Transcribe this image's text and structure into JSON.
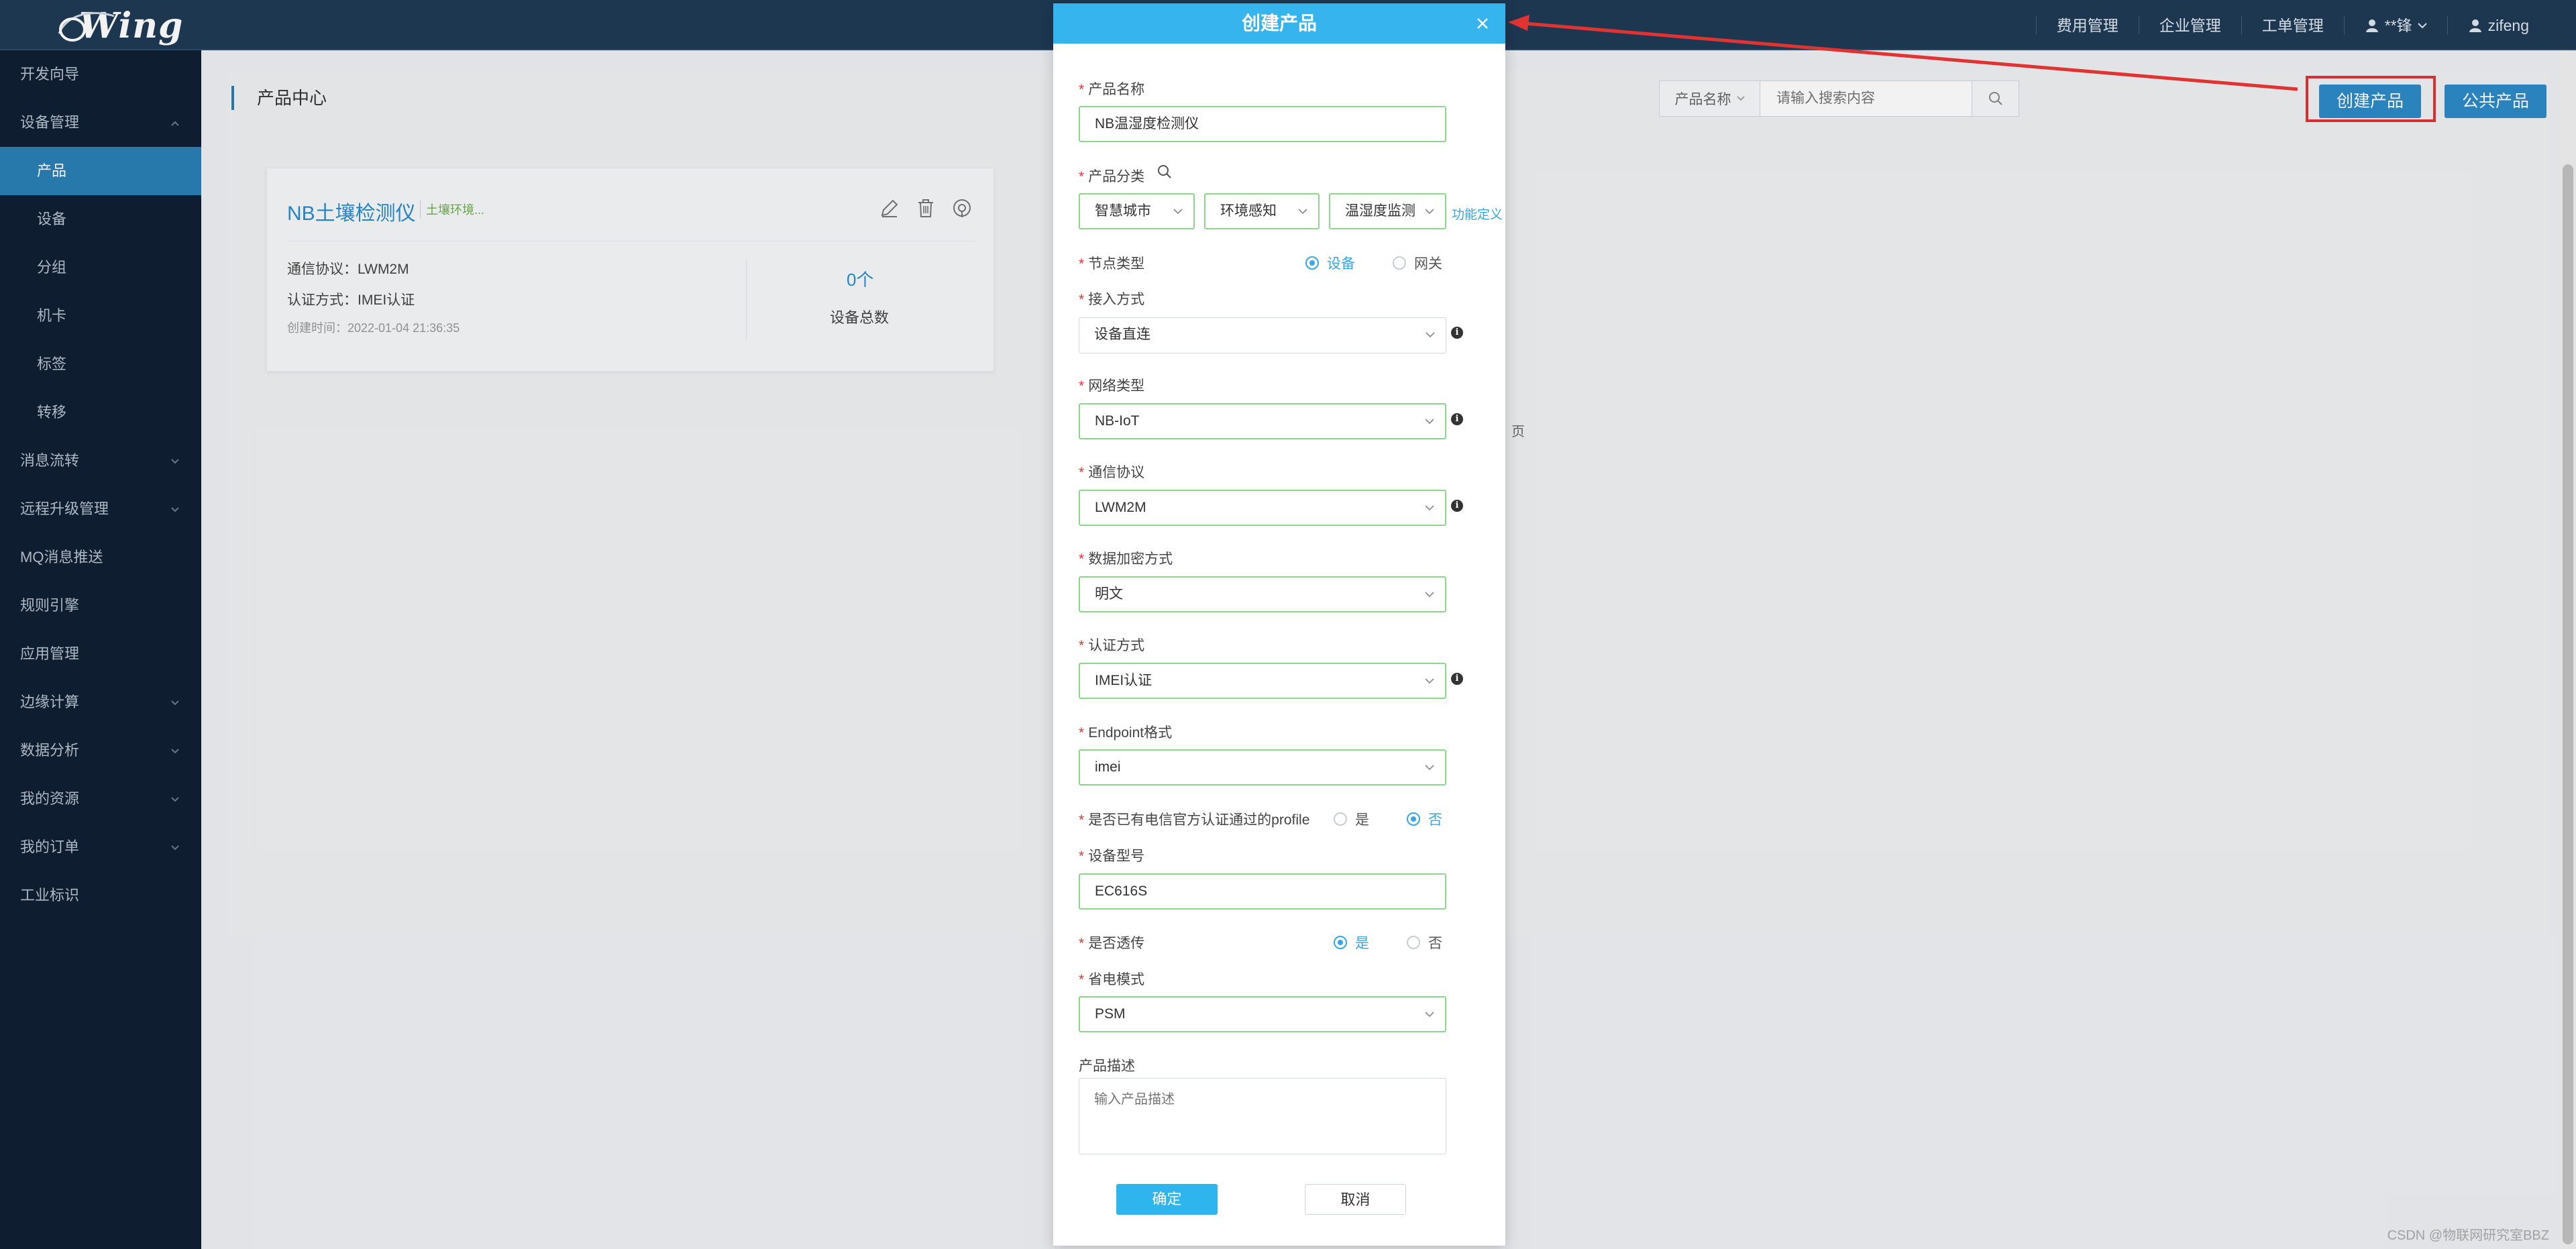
{
  "topbar": {
    "logo": "Wing",
    "nav": [
      "费用管理",
      "企业管理",
      "工单管理"
    ],
    "user_short": "**锋",
    "username": "zifeng"
  },
  "sidebar": {
    "items": [
      {
        "label": "开发向导"
      },
      {
        "label": "设备管理"
      },
      {
        "label": "产品"
      },
      {
        "label": "设备"
      },
      {
        "label": "分组"
      },
      {
        "label": "机卡"
      },
      {
        "label": "标签"
      },
      {
        "label": "转移"
      },
      {
        "label": "消息流转"
      },
      {
        "label": "远程升级管理"
      },
      {
        "label": "MQ消息推送"
      },
      {
        "label": "规则引擎"
      },
      {
        "label": "应用管理"
      },
      {
        "label": "边缘计算"
      },
      {
        "label": "数据分析"
      },
      {
        "label": "我的资源"
      },
      {
        "label": "我的订单"
      },
      {
        "label": "工业标识"
      }
    ]
  },
  "main": {
    "page_title": "产品中心",
    "search_field": "产品名称",
    "search_placeholder": "请输入搜索内容",
    "create_button": "创建产品",
    "public_button": "公共产品",
    "stray": "页",
    "card": {
      "title": "NB土壤检测仪",
      "tag": "土壤环境...",
      "protocol": "通信协议：LWM2M",
      "auth": "认证方式：IMEI认证",
      "created": "创建时间：2022-01-04 21:36:35",
      "count": "0个",
      "count_label": "设备总数"
    }
  },
  "modal": {
    "title": "创建产品",
    "product_name_label": "产品名称",
    "product_name_value": "NB温湿度检测仪",
    "category_label": "产品分类",
    "category_1": "智慧城市",
    "category_2": "环境感知",
    "category_3": "温湿度监测",
    "category_link": "功能定义",
    "node_type_label": "节点类型",
    "node_device": "设备",
    "node_gateway": "网关",
    "access_label": "接入方式",
    "access_value": "设备直连",
    "network_label": "网络类型",
    "network_value": "NB-IoT",
    "protocol_label": "通信协议",
    "protocol_value": "LWM2M",
    "encrypt_label": "数据加密方式",
    "encrypt_value": "明文",
    "auth_label": "认证方式",
    "auth_value": "IMEI认证",
    "endpoint_label": "Endpoint格式",
    "endpoint_value": "imei",
    "profile_label": "是否已有电信官方认证通过的profile",
    "yes": "是",
    "no": "否",
    "model_label": "设备型号",
    "model_value": "EC616S",
    "passthrough_label": "是否透传",
    "power_label": "省电模式",
    "power_value": "PSM",
    "desc_label": "产品描述",
    "desc_placeholder": "输入产品描述",
    "ok": "确定",
    "cancel": "取消"
  },
  "watermark": "CSDN @物联网研究室BBZ",
  "colors": {
    "topbar": "#1f3a56",
    "sidebar": "#0f1f33",
    "accent": "#35b4ee",
    "highlight": "#e23333"
  }
}
